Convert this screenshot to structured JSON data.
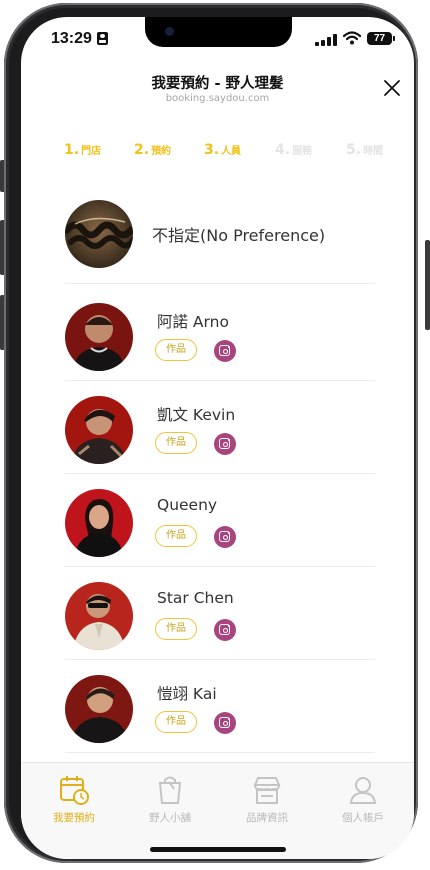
{
  "status_bar": {
    "time": "13:29",
    "battery": "77"
  },
  "header": {
    "title": "我要預約 - 野人理髮",
    "subtitle": "booking.saydou.com"
  },
  "steps": [
    {
      "num": "1.",
      "label": "門店",
      "active": true
    },
    {
      "num": "2.",
      "label": "預約",
      "active": true
    },
    {
      "num": "3.",
      "label": "人員",
      "active": true
    },
    {
      "num": "4.",
      "label": "服務",
      "active": false
    },
    {
      "num": "5.",
      "label": "時間",
      "active": false
    }
  ],
  "no_preference": {
    "label": "不指定(No Preference)"
  },
  "works_label": "作品",
  "stylists": [
    {
      "name": "阿諾 Arno"
    },
    {
      "name": "凱文 Kevin"
    },
    {
      "name": "Queeny"
    },
    {
      "name": "Star Chen"
    },
    {
      "name": "愷翊 Kai"
    }
  ],
  "tabs": [
    {
      "label": "我要預約",
      "icon": "calendar-clock-icon",
      "active": true
    },
    {
      "label": "野人小舖",
      "icon": "shopping-bag-icon",
      "active": false
    },
    {
      "label": "品牌資訊",
      "icon": "storefront-icon",
      "active": false
    },
    {
      "label": "個人帳戶",
      "icon": "user-icon",
      "active": false
    }
  ],
  "colors": {
    "accent": "#F0C21A",
    "instagram": "#A8457E",
    "inactive_step": "#E3E3E3"
  }
}
